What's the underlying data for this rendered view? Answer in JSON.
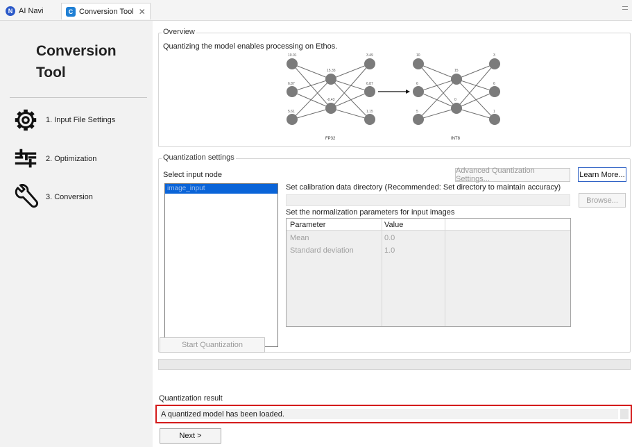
{
  "tabs": [
    {
      "label": "AI Navi",
      "icon": "ai-navi-icon",
      "color": "#2a58c8"
    },
    {
      "label": "Conversion Tool",
      "icon": "conversion-tool-icon",
      "color": "#1f7fd4",
      "active": true
    }
  ],
  "sidebar": {
    "title": "Conversion Tool",
    "steps": [
      {
        "label": "1. Input File Settings",
        "icon": "gear-icon"
      },
      {
        "label": "2. Optimization",
        "icon": "sliders-icon"
      },
      {
        "label": "3. Conversion",
        "icon": "wrench-icon"
      }
    ]
  },
  "overview": {
    "group_label": "Overview",
    "description": "Quantizing the model enables processing on Ethos.",
    "fp32_label": "FP32",
    "int8_label": "INT8",
    "fp32_weights": [
      "10.01",
      "3.49",
      "15.33",
      "6.87",
      "6.87",
      "-0.43",
      "5.61",
      "1.15"
    ],
    "int8_weights": [
      "10",
      "3",
      "15",
      "6",
      "6",
      "0",
      "5",
      "1"
    ]
  },
  "quantization": {
    "group_label": "Quantization settings",
    "select_node_label": "Select input node",
    "selected_node": "image_input",
    "advanced_button": "Advanced Quantization Settings...",
    "learn_more_button": "Learn More...",
    "calibration_label": "Set calibration data directory (Recommended: Set directory to maintain accuracy)",
    "calibration_value": "",
    "browse_button": "Browse...",
    "normalization_label": "Set the normalization parameters for input images",
    "table": {
      "headers": [
        "Parameter",
        "Value"
      ],
      "rows": [
        {
          "parameter": "Mean",
          "value": "0.0"
        },
        {
          "parameter": "Standard deviation",
          "value": "1.0"
        }
      ]
    }
  },
  "actions": {
    "start_button": "Start Quantization",
    "progress": 0,
    "result_label": "Quantization result",
    "result_text": "A quantized model has been loaded.",
    "next_button": "Next >"
  },
  "colors": {
    "accent": "#0a64d8",
    "highlight_border": "#d41b1b",
    "focus_border": "#2f62c5",
    "node_gray": "#7b7b7b"
  }
}
